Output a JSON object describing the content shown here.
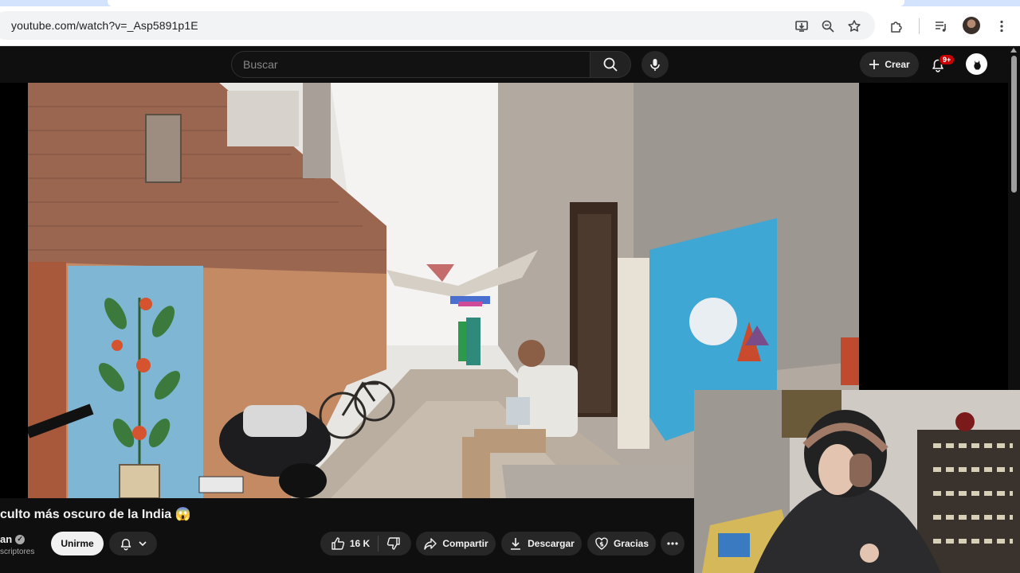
{
  "browser": {
    "url": "youtube.com/watch?v=_Asp5891p1E",
    "icons": [
      "install-app-icon",
      "zoom-icon",
      "bookmark-star-icon",
      "extensions-icon",
      "media-control-icon",
      "profile-avatar",
      "more-menu-icon"
    ]
  },
  "masthead": {
    "search_placeholder": "Buscar",
    "create_label": "Crear",
    "notifications_badge": "9+"
  },
  "video": {
    "title": "culto más oscuro de la India 😱",
    "channel_name": "an",
    "subscribers_text": "scriptores",
    "join_label": "Unirme",
    "like_count": "16 K",
    "share_label": "Compartir",
    "download_label": "Descargar",
    "thanks_label": "Gracias"
  },
  "colors": {
    "yt_background": "#0f0f0f",
    "button_background": "#272727",
    "notification_red": "#cc0000",
    "browser_toolbar": "#ffffff"
  }
}
